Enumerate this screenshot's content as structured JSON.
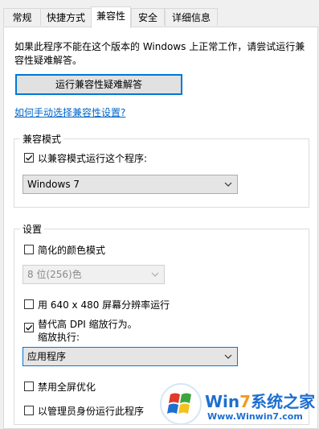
{
  "tabs": [
    "常规",
    "快捷方式",
    "兼容性",
    "安全",
    "详细信息"
  ],
  "active_tab": "兼容性",
  "description": "如果此程序不能在这个版本的 Windows 上正常工作，请尝试运行兼容性疑难解答。",
  "troubleshooter_button": "运行兼容性疑难解答",
  "manual_link": "如何手动选择兼容性设置?",
  "compat_mode": {
    "legend": "兼容模式",
    "checkbox_label": "以兼容模式运行这个程序:",
    "checked": true,
    "selected_os": "Windows 7"
  },
  "settings": {
    "legend": "设置",
    "reduced_color": {
      "label": "简化的颜色模式",
      "checked": false
    },
    "color_select": "8 位(256)色",
    "low_res": {
      "label": "用 640 x 480 屏幕分辨率运行",
      "checked": false
    },
    "dpi_override": {
      "label_line1": "替代高 DPI 缩放行为。",
      "label_line2": "缩放执行:",
      "checked": true
    },
    "dpi_select": "应用程序",
    "fullscreen_opt": {
      "label": "禁用全屏优化",
      "checked": false
    },
    "run_as_admin": {
      "label": "以管理员身份运行此程序",
      "checked": false
    }
  },
  "watermark": {
    "brand_prefix": "Wi",
    "brand_seven": "7",
    "brand_suffix": "系统之家",
    "url": "Www.Winwin7.com",
    "colors": {
      "blue": "#1d6fd0",
      "orange": "#f39a1e",
      "green": "#3ca63c",
      "red": "#e03a2a"
    }
  },
  "colors": {
    "accent": "#0078d7",
    "link": "#0066cc",
    "border": "#d9d9d9"
  }
}
